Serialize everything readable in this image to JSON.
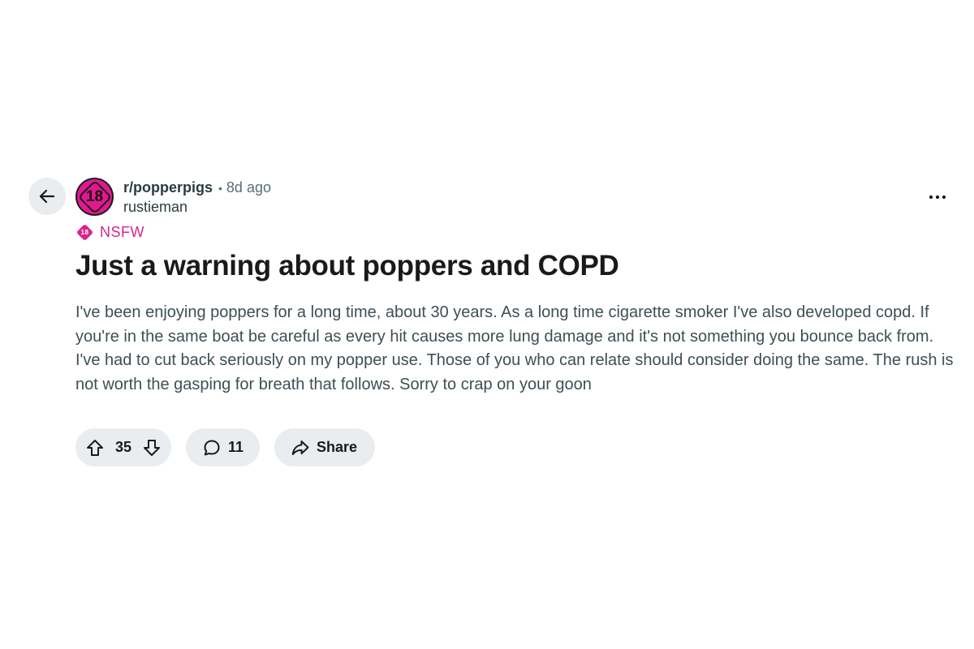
{
  "post": {
    "subreddit": "r/popperpigs",
    "separator": "•",
    "time_ago": "8d ago",
    "author": "rustieman",
    "avatar_text": "18",
    "nsfw_badge_text": "18",
    "nsfw_label": "NSFW",
    "title": "Just a warning about poppers and COPD",
    "body": "I've been enjoying poppers for a long time, about 30 years. As a long time cigarette smoker I've also developed copd. If you're in the same boat be careful as every hit causes more lung damage and it's not something you bounce back from. I've had to cut back seriously on my popper use. Those of you who can relate should consider doing the same. The rush is not worth the gasping for breath that follows. Sorry to crap on your goon"
  },
  "actions": {
    "vote_count": "35",
    "comment_count": "11",
    "share_label": "Share"
  },
  "icons": {
    "back": "arrow-left-icon",
    "more": "more-horizontal-icon",
    "upvote": "arrow-up-icon",
    "downvote": "arrow-down-icon",
    "comment": "speech-bubble-icon",
    "share": "share-arrow-icon"
  },
  "colors": {
    "nsfw_accent": "#d9248b",
    "pill_background": "#e9edef",
    "text_primary": "#1a1a1b",
    "text_secondary": "#576f76"
  }
}
